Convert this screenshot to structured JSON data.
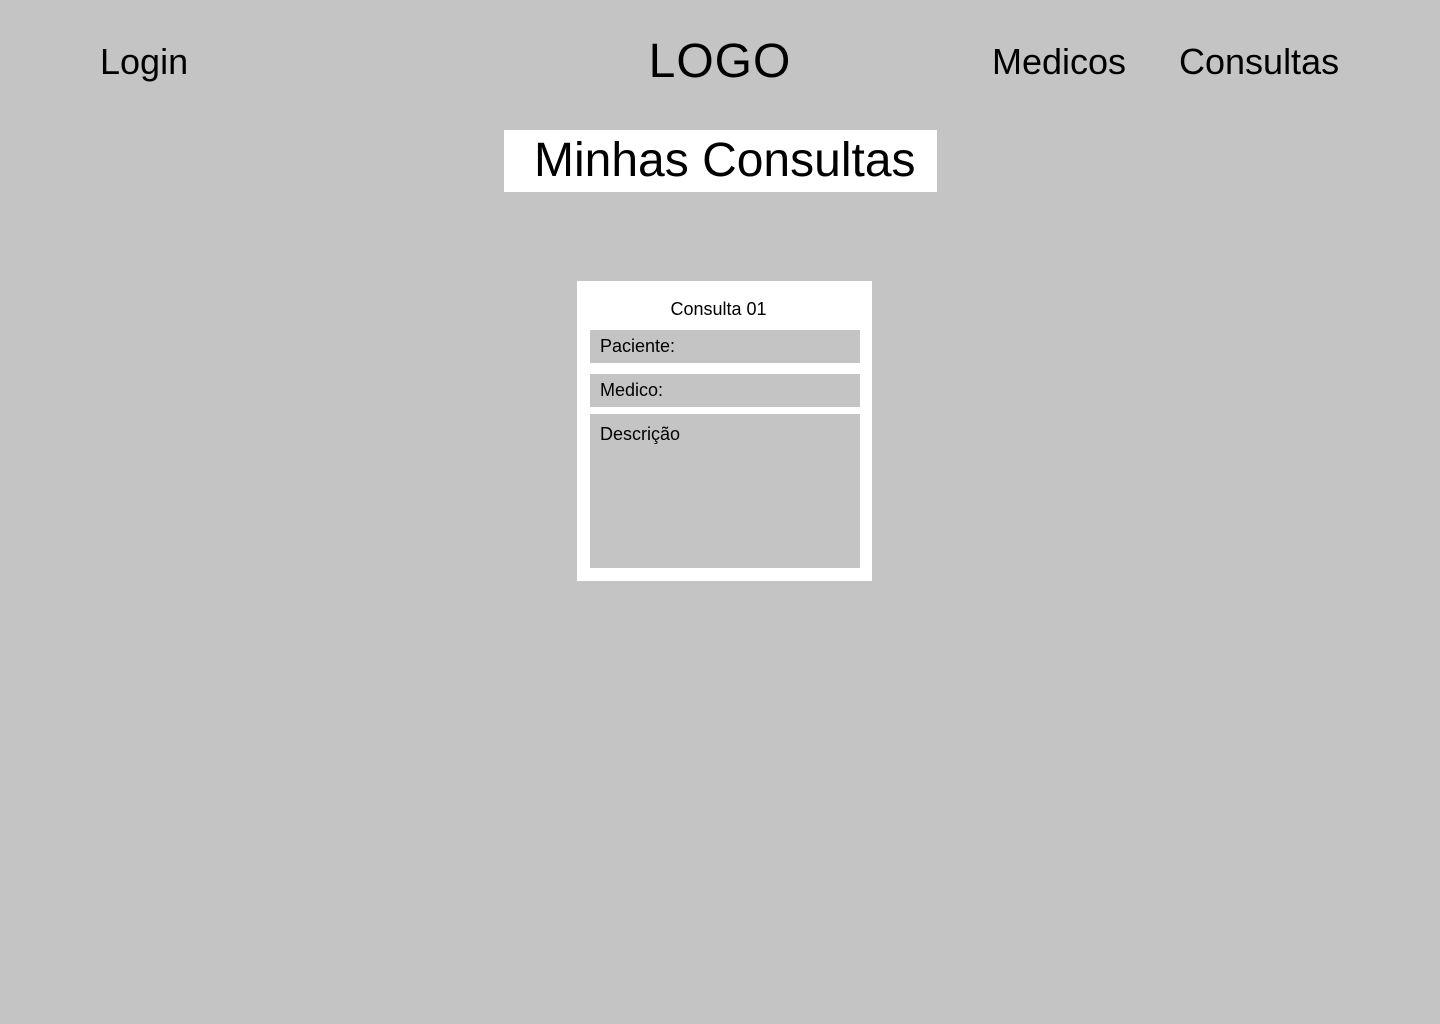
{
  "header": {
    "login_label": "Login",
    "logo_text": "LOGO",
    "nav": {
      "medicos_label": "Medicos",
      "consultas_label": "Consultas"
    }
  },
  "main": {
    "title": "Minhas Consultas",
    "consulta_card": {
      "title": "Consulta 01",
      "paciente_label": "Paciente:",
      "medico_label": "Medico:",
      "descricao_label": "Descrição"
    }
  },
  "colors": {
    "background": "#c4c4c4",
    "panel": "#ffffff",
    "text": "#000000"
  }
}
